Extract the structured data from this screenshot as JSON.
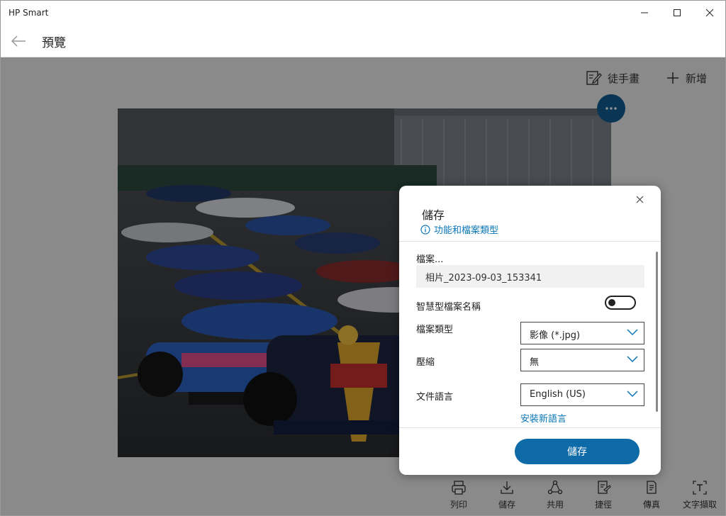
{
  "app": {
    "title": "HP Smart"
  },
  "header": {
    "title": "預覽"
  },
  "toolbar": {
    "draw_label": "徒手畫",
    "add_label": "新增"
  },
  "bottom_bar": {
    "items": [
      {
        "label": "列印",
        "icon": "printer-icon"
      },
      {
        "label": "儲存",
        "icon": "download-icon"
      },
      {
        "label": "共用",
        "icon": "share-icon"
      },
      {
        "label": "捷徑",
        "icon": "shortcut-icon"
      },
      {
        "label": "傳真",
        "icon": "fax-icon"
      },
      {
        "label": "文字擷取",
        "icon": "text-extract-icon"
      }
    ]
  },
  "dialog": {
    "title": "儲存",
    "info_link": "功能和檔案類型",
    "file_label": "檔案...",
    "file_name": "相片_2023-09-03_153341",
    "smart_name_label": "智慧型檔案名稱",
    "smart_name_on": false,
    "file_type_label": "檔案類型",
    "file_type_value": "影像 (*.jpg)",
    "compression_label": "壓縮",
    "compression_value": "無",
    "language_label": "文件語言",
    "language_value": "English (US)",
    "install_language_link": "安裝新語言",
    "save_button": "儲存"
  },
  "colors": {
    "accent": "#0e6ba8",
    "link": "#0a76b5",
    "more_button": "#0e5d92"
  }
}
